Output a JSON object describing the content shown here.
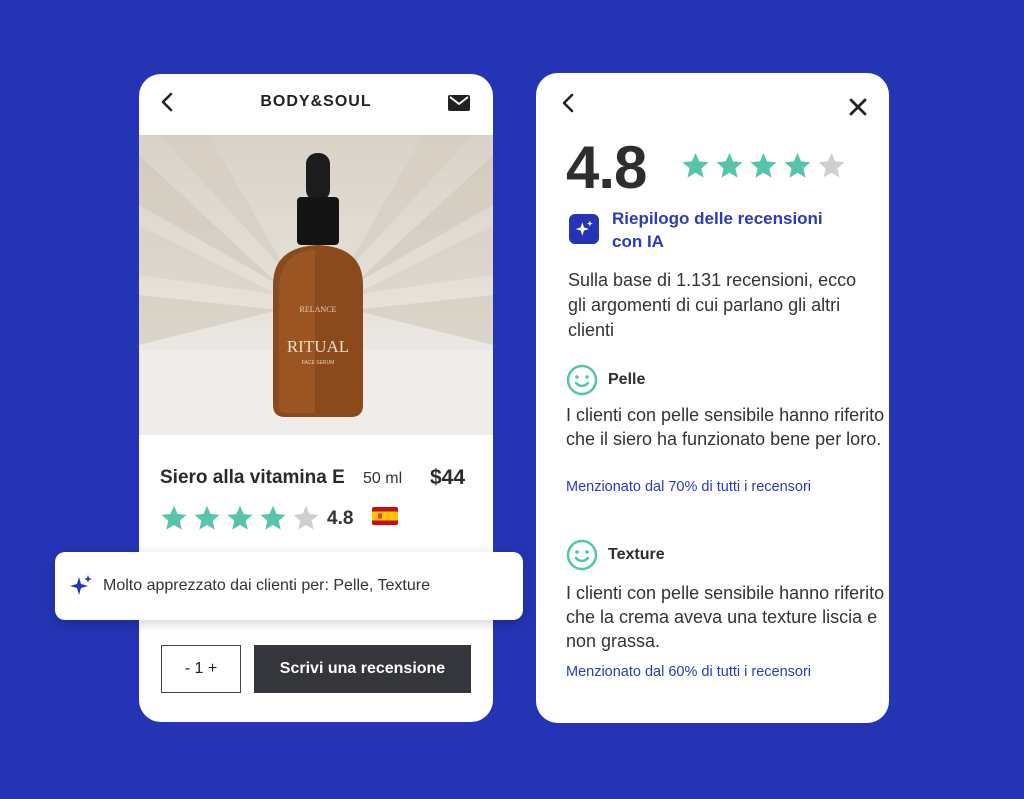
{
  "colors": {
    "background": "#2434b4",
    "accent": "#2b3bb8",
    "star": "#55c4a8",
    "star_empty": "#cfcfcf",
    "button_dark": "#34363b"
  },
  "product_screen": {
    "brand": "BODY&SOUL",
    "icons": {
      "back": "chevron-left-icon",
      "mail": "mail-icon"
    },
    "bottle_label": {
      "brand": "RELANCE",
      "name": "RITUAL",
      "sub": "FACE SERUM"
    },
    "product": {
      "name": "Siero alla vitamina E",
      "size": "50 ml",
      "price": "$44",
      "rating": "4.8",
      "stars_filled": 4,
      "stars_total": 5
    },
    "ai_banner": {
      "text": "Molto apprezzato dai clienti per: Pelle, Texture"
    },
    "quantity": "- 1 +",
    "write_review": "Scrivi una recensione"
  },
  "review_summary": {
    "icons": {
      "back": "chevron-left-icon",
      "close": "close-icon"
    },
    "rating": "4.8",
    "stars_filled": 4,
    "stars_total": 5,
    "ai_title": "Riepilogo delle recensioni con IA",
    "intro": "Sulla base di 1.131 recensioni, ecco gli argomenti di cui parlano gli altri clienti",
    "topics": [
      {
        "title": "Pelle",
        "text": "I clienti con pelle sensibile hanno riferito che il siero ha funzionato bene per loro.",
        "mentioned": "Menzionato dal 70% di tutti i recensori"
      },
      {
        "title": "Texture",
        "text": "I clienti con pelle sensibile hanno riferito che la crema aveva una texture liscia e non grassa.",
        "mentioned": "Menzionato dal 60% di tutti i recensori"
      }
    ]
  }
}
